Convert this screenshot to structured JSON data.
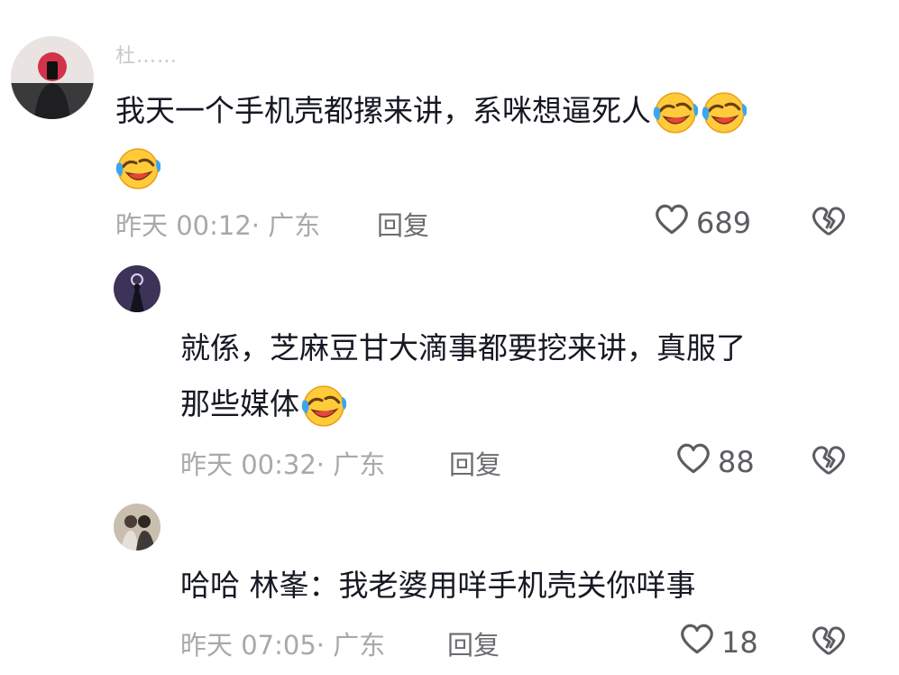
{
  "comments": [
    {
      "username": "杜……",
      "text": "我天一个手机壳都摞来讲，系咪想逼死人",
      "emoji_count": 3,
      "time": "昨天 00:12",
      "location": "· 广东",
      "reply_label": "回复",
      "likes": "689",
      "icons": {
        "like": "heart-outline-icon",
        "dislike": "broken-heart-icon",
        "emoji": "rofl-emoji-icon"
      }
    },
    {
      "username": "",
      "text_line1": "就係，芝麻豆甘大滴事都要挖来讲，真服了",
      "text_line2": "那些媒体",
      "time": "昨天 00:32",
      "location": "· 广东",
      "reply_label": "回复",
      "likes": "88"
    },
    {
      "username": "",
      "text": "哈哈 林峯：我老婆用咩手机壳关你咩事",
      "time": "昨天 07:05",
      "location": "· 广东",
      "reply_label": "回复",
      "likes": "18"
    }
  ],
  "colors": {
    "text": "#161823",
    "meta": "#a8a8ad",
    "reply": "#6b6b70",
    "icon": "#5c5c62"
  }
}
